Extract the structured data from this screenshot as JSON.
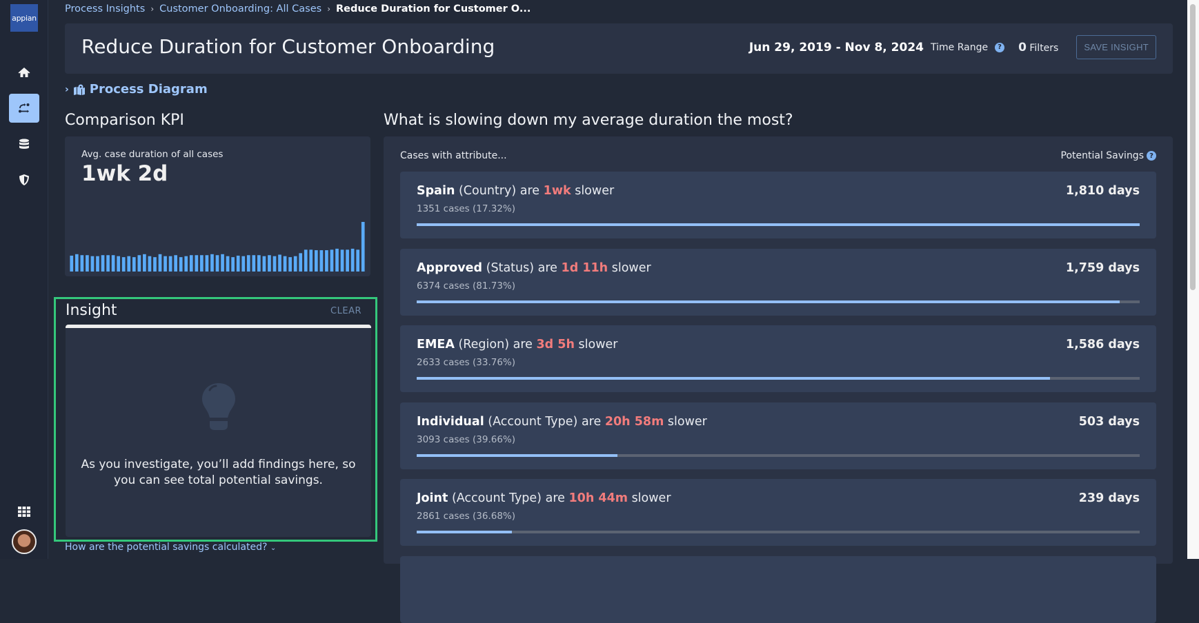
{
  "sidebar": {
    "logo": "appian",
    "items": [
      {
        "name": "home",
        "icon": "home-icon"
      },
      {
        "name": "process-insights",
        "icon": "process-flow-icon",
        "active": true
      },
      {
        "name": "data",
        "icon": "database-icon"
      },
      {
        "name": "security",
        "icon": "shield-icon"
      }
    ],
    "apps_icon": "grid-icon",
    "avatar": "user-avatar"
  },
  "breadcrumb": {
    "items": [
      "Process Insights",
      "Customer Onboarding: All Cases"
    ],
    "current": "Reduce Duration for Customer O..."
  },
  "header": {
    "title": "Reduce Duration for Customer Onboarding",
    "date_range": "Jun 29, 2019 - Nov 8, 2024",
    "time_range_label": "Time Range",
    "filters_count": "0",
    "filters_label": "Filters",
    "save_label": "SAVE INSIGHT"
  },
  "process_diagram": {
    "label": "Process Diagram"
  },
  "kpi": {
    "section_title": "Comparison KPI",
    "label": "Avg. case duration of all cases",
    "value": "1wk 2d",
    "sparkline": [
      0.32,
      0.35,
      0.33,
      0.33,
      0.31,
      0.31,
      0.33,
      0.33,
      0.33,
      0.31,
      0.29,
      0.31,
      0.29,
      0.33,
      0.35,
      0.31,
      0.29,
      0.35,
      0.31,
      0.31,
      0.33,
      0.29,
      0.31,
      0.33,
      0.33,
      0.33,
      0.33,
      0.35,
      0.33,
      0.35,
      0.31,
      0.29,
      0.32,
      0.31,
      0.33,
      0.33,
      0.33,
      0.31,
      0.33,
      0.31,
      0.34,
      0.31,
      0.29,
      0.31,
      0.37,
      0.44,
      0.44,
      0.43,
      0.43,
      0.43,
      0.44,
      0.46,
      0.44,
      0.44,
      0.46,
      0.44,
      1.0
    ]
  },
  "insight": {
    "title": "Insight",
    "clear_label": "CLEAR",
    "empty_message": "As you investigate, you’ll add findings here, so you can see total potential savings.",
    "how_link": "How are the potential savings calculated?"
  },
  "slowdown": {
    "section_title": "What is slowing down my average duration the most?",
    "cases_with_label": "Cases with attribute...",
    "potential_savings_label": "Potential Savings",
    "items": [
      {
        "value": "Spain",
        "attribute": "(Country)",
        "are": "are",
        "delta": "1wk",
        "slower": "slower",
        "cases": "1351 cases (17.32%)",
        "savings": "1,810 days",
        "bar_fraction": 1.0
      },
      {
        "value": "Approved",
        "attribute": "(Status)",
        "are": "are",
        "delta": "1d 11h",
        "slower": "slower",
        "cases": "6374 cases (81.73%)",
        "savings": "1,759 days",
        "bar_fraction": 0.972
      },
      {
        "value": "EMEA",
        "attribute": "(Region)",
        "are": "are",
        "delta": "3d 5h",
        "slower": "slower",
        "cases": "2633 cases (33.76%)",
        "savings": "1,586 days",
        "bar_fraction": 0.876
      },
      {
        "value": "Individual",
        "attribute": "(Account Type)",
        "are": "are",
        "delta": "20h 58m",
        "slower": "slower",
        "cases": "3093 cases (39.66%)",
        "savings": "503 days",
        "bar_fraction": 0.278
      },
      {
        "value": "Joint",
        "attribute": "(Account Type)",
        "are": "are",
        "delta": "10h 44m",
        "slower": "slower",
        "cases": "2861 cases (36.68%)",
        "savings": "239 days",
        "bar_fraction": 0.132
      }
    ]
  },
  "colors": {
    "accent": "#9ec6fb",
    "delta": "#f27c7c",
    "bar_fill": "#93bff6",
    "sparkline": "#5aabf8",
    "insight_border": "#34c77b"
  }
}
